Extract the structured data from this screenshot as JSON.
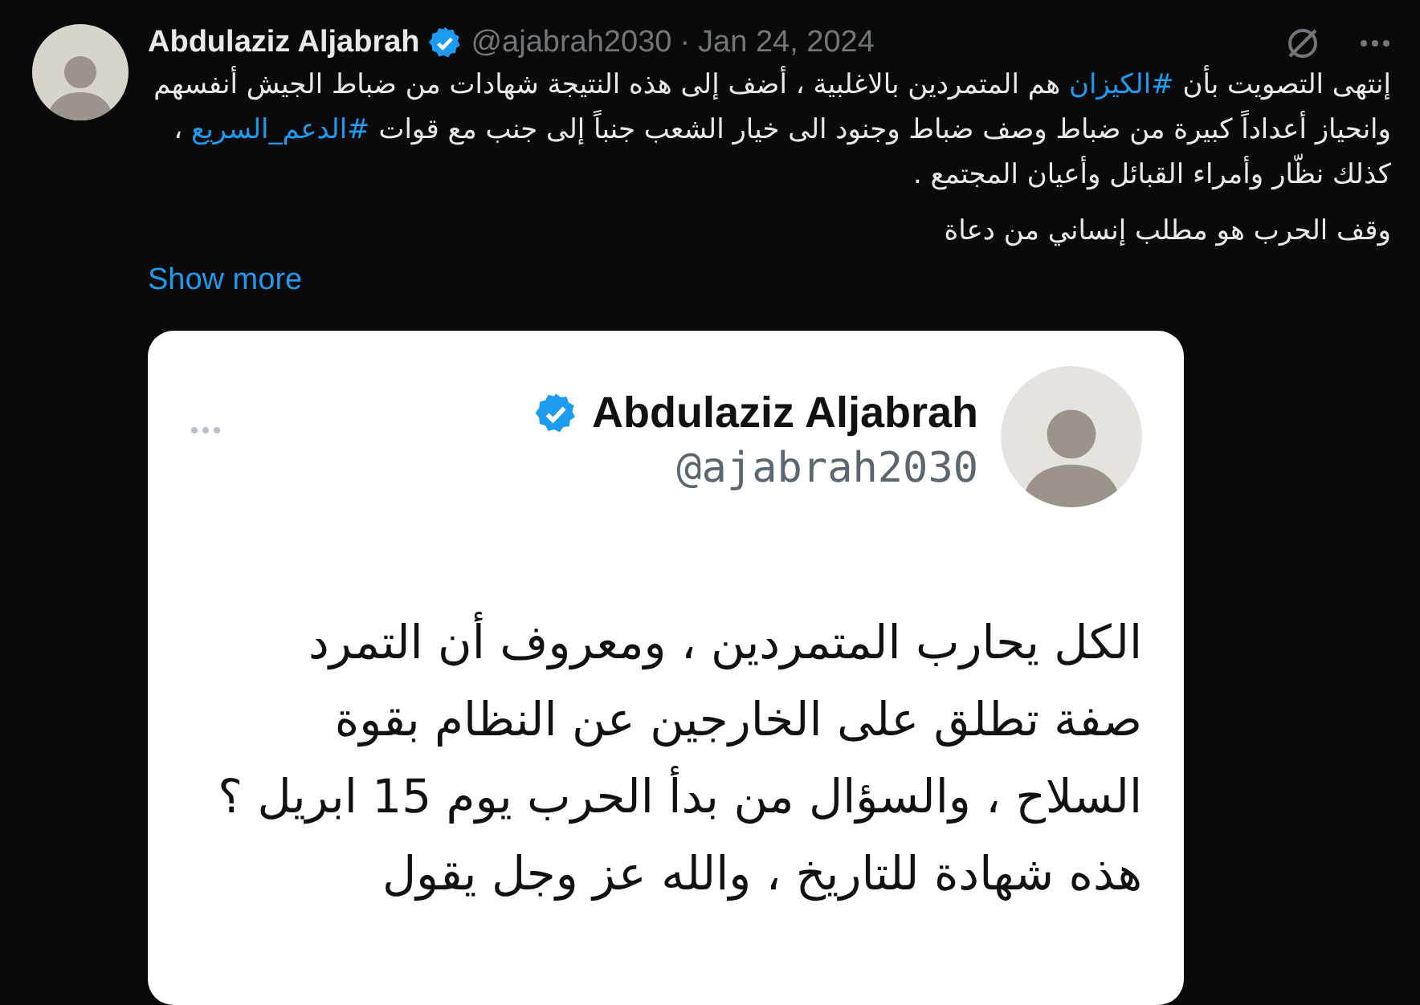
{
  "tweet": {
    "author": {
      "name": "Abdulaziz Aljabrah",
      "verified": true,
      "handle": "@ajabrah2030",
      "separator": "·",
      "date": "Jan 24, 2024"
    },
    "paragraphs": [
      [
        {
          "kind": "text",
          "text": "إنتهى التصويت بأن "
        },
        {
          "kind": "hashtag",
          "text": "#الكيزان"
        },
        {
          "kind": "text",
          "text": " هم المتمردين بالاغلبية ، أضف إلى هذه النتيجة شهادات من ضباط الجيش أنفسهم وانحياز أعداداً كبيرة من ضباط وصف ضباط وجنود الى خيار الشعب جنباً إلى جنب مع قوات "
        },
        {
          "kind": "hashtag",
          "text": "#الدعم_السريع"
        },
        {
          "kind": "text",
          "text": " ، كذلك نظّار وأمراء القبائل وأعيان المجتمع ."
        }
      ],
      [
        {
          "kind": "text",
          "text": "وقف الحرب هو مطلب إنساني من دعاة"
        }
      ]
    ],
    "show_more": "Show more",
    "embedded": {
      "author": {
        "name": "Abdulaziz Aljabrah",
        "verified": true,
        "handle": "@ajabrah2030"
      },
      "lines": [
        "الكل يحارب المتمردين ، ومعروف أن التمرد",
        "صفة تطلق على الخارجين عن النظام بقوة",
        "السلاح ، والسؤال من بدأ الحرب يوم 15 ابريل ؟",
        "هذه شهادة للتاريخ ، والله عز وجل يقول"
      ]
    }
  }
}
